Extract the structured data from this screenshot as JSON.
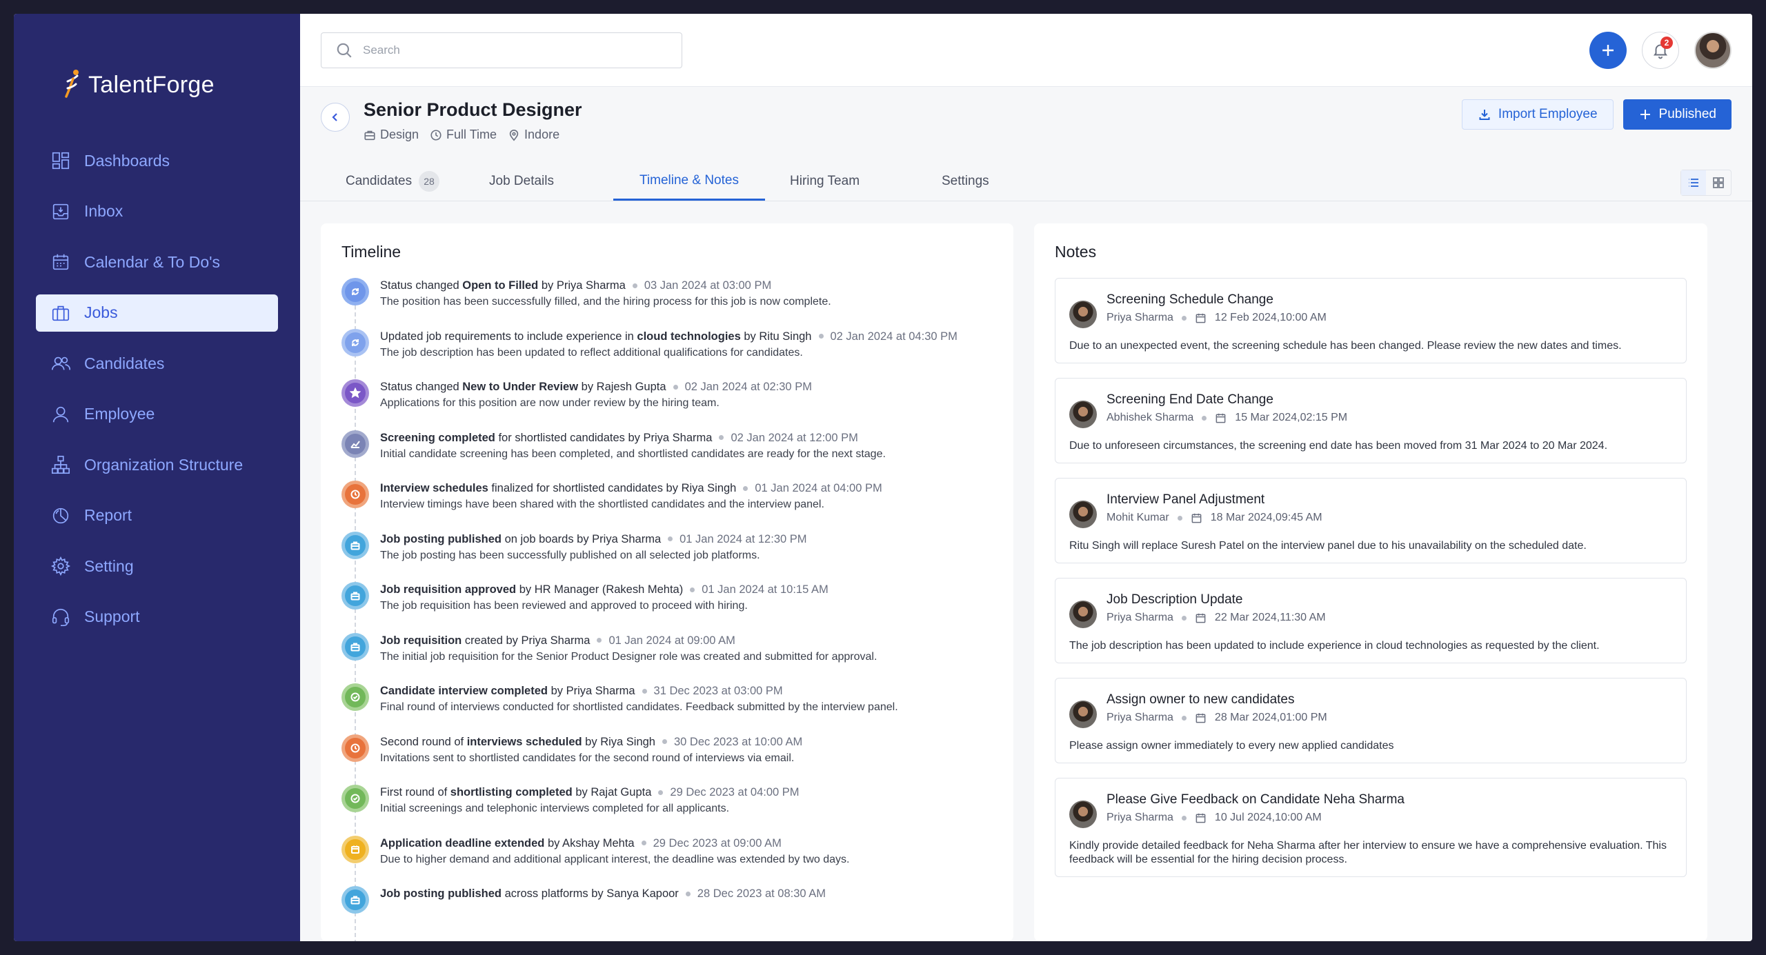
{
  "app": {
    "name": "TalentForge"
  },
  "sidebar": {
    "items": [
      {
        "label": "Dashboards",
        "icon": "dashboard-icon"
      },
      {
        "label": "Inbox",
        "icon": "inbox-icon"
      },
      {
        "label": "Calendar & To Do's",
        "icon": "calendar-icon"
      },
      {
        "label": "Jobs",
        "icon": "briefcase-icon",
        "active": true
      },
      {
        "label": "Candidates",
        "icon": "users-icon"
      },
      {
        "label": "Employee",
        "icon": "user-icon"
      },
      {
        "label": "Organization Structure",
        "icon": "org-icon"
      },
      {
        "label": "Report",
        "icon": "report-icon"
      },
      {
        "label": "Setting",
        "icon": "gear-icon"
      },
      {
        "label": "Support",
        "icon": "headset-icon"
      }
    ]
  },
  "topbar": {
    "search_placeholder": "Search",
    "notification_count": "2"
  },
  "job": {
    "title": "Senior Product Designer",
    "department": "Design",
    "type": "Full Time",
    "location": "Indore",
    "import_label": "Import Employee",
    "publish_label": "Published"
  },
  "tabs": [
    {
      "label": "Candidates",
      "count": "28"
    },
    {
      "label": "Job Details"
    },
    {
      "label": "Timeline & Notes",
      "active": true
    },
    {
      "label": "Hiring Team"
    },
    {
      "label": "Settings"
    }
  ],
  "timeline": {
    "title": "Timeline",
    "items": [
      {
        "pre": "Status changed ",
        "bold": "Open to Filled",
        "post": " by Priya Sharma",
        "date": "03 Jan 2024 at 03:00 PM",
        "desc": "The position has been successfully filled, and the hiring process for this job is now complete.",
        "color": "#8fb0f0",
        "inner": "#6f96ea",
        "icon": "refresh-icon"
      },
      {
        "pre": "Updated job requirements to include experience in ",
        "bold": "cloud technologies",
        "post": " by Ritu Singh",
        "date": "02 Jan 2024 at 04:30 PM",
        "desc": "The job description has been updated to reflect additional qualifications for candidates.",
        "color": "#a9c2f3",
        "inner": "#7fa2ec",
        "icon": "refresh-icon"
      },
      {
        "pre": "Status changed ",
        "bold": "New to Under Review",
        "post": " by Rajesh Gupta",
        "date": "02 Jan 2024 at 02:30 PM",
        "desc": "Applications for this position are now under review by the hiring team.",
        "color": "#a48ad8",
        "inner": "#7b57c7",
        "icon": "star-icon"
      },
      {
        "pre": "",
        "bold": "Screening completed",
        "post": " for shortlisted candidates by Priya Sharma",
        "date": "02 Jan 2024 at 12:00 PM",
        "desc": "Initial candidate screening has been completed, and shortlisted candidates are ready for the next stage.",
        "color": "#a2aacd",
        "inner": "#7b84b5",
        "icon": "chart-icon"
      },
      {
        "pre": "",
        "bold": "Interview schedules",
        "post": " finalized for shortlisted candidates by Riya Singh",
        "date": "01 Jan 2024 at 04:00 PM",
        "desc": "Interview timings have been shared with the shortlisted candidates and the interview panel.",
        "color": "#f0a57d",
        "inner": "#e8733c",
        "icon": "clock-icon"
      },
      {
        "pre": "",
        "bold": "Job posting published",
        "post": " on job boards by Priya Sharma",
        "date": "01 Jan 2024 at 12:30 PM",
        "desc": "The job posting has been successfully published on all selected job platforms.",
        "color": "#8cc7ea",
        "inner": "#42a5dc",
        "icon": "briefcase-icon"
      },
      {
        "pre": "",
        "bold": "Job requisition approved",
        "post": " by HR Manager (Rakesh Mehta)",
        "date": "01 Jan 2024 at 10:15 AM",
        "desc": "The job requisition has been reviewed and approved to proceed with hiring.",
        "color": "#8cc7ea",
        "inner": "#42a5dc",
        "icon": "briefcase-icon"
      },
      {
        "pre": "",
        "bold": "Job requisition",
        "post": " created by Priya Sharma",
        "date": "01 Jan 2024 at 09:00 AM",
        "desc": "The initial job requisition for the Senior Product Designer role was created and submitted for approval.",
        "color": "#8cc7ea",
        "inner": "#42a5dc",
        "icon": "briefcase-icon"
      },
      {
        "pre": "",
        "bold": "Candidate interview completed",
        "post": " by Priya Sharma",
        "date": "31 Dec 2023 at 03:00 PM",
        "desc": "Final round of interviews conducted for shortlisted candidates. Feedback submitted by the interview panel.",
        "color": "#a8d494",
        "inner": "#72b85a",
        "icon": "check-icon"
      },
      {
        "pre": "Second round of ",
        "bold": "interviews scheduled",
        "post": " by Riya Singh",
        "date": "30 Dec 2023 at 10:00 AM",
        "desc": "Invitations sent to shortlisted candidates for the second round of interviews via email.",
        "color": "#f0a57d",
        "inner": "#e8733c",
        "icon": "clock-icon"
      },
      {
        "pre": "First round of ",
        "bold": "shortlisting completed",
        "post": " by Rajat Gupta",
        "date": "29 Dec 2023 at 04:00 PM",
        "desc": "Initial screenings and telephonic interviews completed for all applicants.",
        "color": "#a8d494",
        "inner": "#72b85a",
        "icon": "check-icon"
      },
      {
        "pre": "",
        "bold": "Application deadline extended",
        "post": " by Akshay Mehta",
        "date": "29 Dec 2023 at 09:00 AM",
        "desc": "Due to higher demand and additional applicant interest, the deadline was extended by two days.",
        "color": "#f3cd6f",
        "inner": "#efb120",
        "icon": "calendar-icon"
      },
      {
        "pre": "",
        "bold": "Job posting published",
        "post": " across platforms by Sanya Kapoor",
        "date": "28 Dec 2023 at 08:30 AM",
        "desc": "",
        "color": "#8cc7ea",
        "inner": "#42a5dc",
        "icon": "briefcase-icon"
      }
    ]
  },
  "notes": {
    "title": "Notes",
    "items": [
      {
        "title": "Screening Schedule Change",
        "author": "Priya Sharma",
        "date": "12 Feb 2024,10:00 AM",
        "body": "Due to an unexpected event, the screening schedule has been changed. Please review the new dates and times."
      },
      {
        "title": "Screening End Date Change",
        "author": "Abhishek Sharma",
        "date": "15 Mar 2024,02:15 PM",
        "body": "Due to unforeseen circumstances, the screening end date has been moved from 31 Mar 2024 to 20 Mar 2024."
      },
      {
        "title": "Interview Panel Adjustment",
        "author": "Mohit Kumar",
        "date": "18 Mar 2024,09:45 AM",
        "body": "Ritu Singh will replace Suresh Patel on the interview panel due to his unavailability on the scheduled date."
      },
      {
        "title": "Job Description Update",
        "author": "Priya Sharma",
        "date": "22 Mar 2024,11:30 AM",
        "body": "The job description has been updated to include experience in cloud technologies as requested by the client."
      },
      {
        "title": "Assign owner to new candidates",
        "author": "Priya Sharma",
        "date": "28 Mar 2024,01:00 PM",
        "body": "Please assign owner immediately to every new applied candidates"
      },
      {
        "title": "Please Give Feedback on Candidate Neha Sharma",
        "author": "Priya Sharma",
        "date": "10 Jul 2024,10:00 AM",
        "body": "Kindly provide detailed feedback for Neha Sharma after her interview to ensure we have a comprehensive evaluation. This feedback will be essential for the hiring decision process."
      }
    ]
  }
}
